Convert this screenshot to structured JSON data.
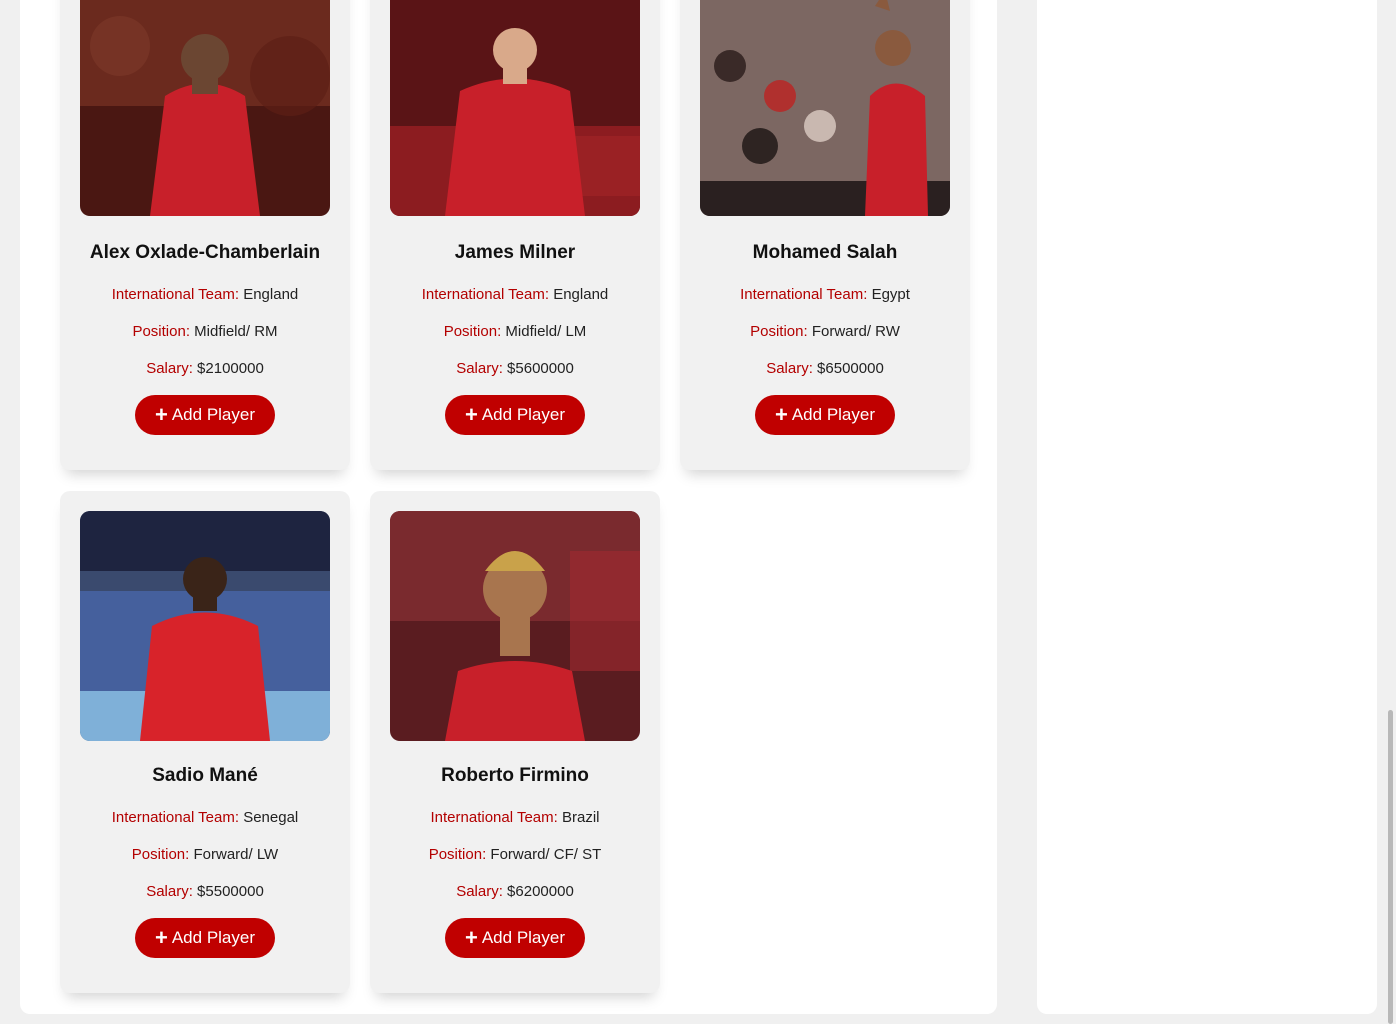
{
  "labels": {
    "international_team": "International Team:",
    "position": "Position:",
    "salary": "Salary:",
    "add_button": "Add Player"
  },
  "players": [
    {
      "name": "Alex Oxlade-Chamberlain",
      "international_team": "England",
      "position": "Midfield/ RM",
      "salary": "$2100000"
    },
    {
      "name": "James Milner",
      "international_team": "England",
      "position": "Midfield/ LM",
      "salary": "$5600000"
    },
    {
      "name": "Mohamed Salah",
      "international_team": "Egypt",
      "position": "Forward/ RW",
      "salary": "$6500000"
    },
    {
      "name": "Sadio Mané",
      "international_team": "Senegal",
      "position": "Forward/ LW",
      "salary": "$5500000"
    },
    {
      "name": "Roberto Firmino",
      "international_team": "Brazil",
      "position": "Forward/ CF/ ST",
      "salary": "$6200000"
    }
  ],
  "colors": {
    "accent": "#c00000",
    "label": "#b30000",
    "card_bg": "#f1f1f1",
    "page_bg": "#f0f0f0"
  },
  "icons": {
    "add": "plus-icon"
  }
}
